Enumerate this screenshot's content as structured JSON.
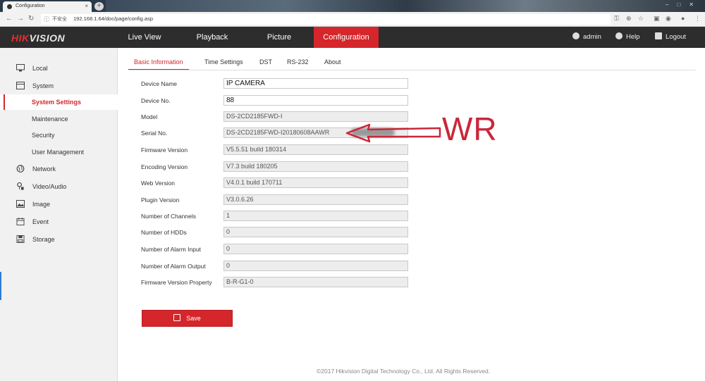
{
  "browser": {
    "tab_title": "Configuration",
    "tab_close": "×",
    "new_tab": "+",
    "address": {
      "security_warning": "不安全",
      "url": "192.168.1.64/doc/page/config.asp"
    }
  },
  "header": {
    "logo_red": "HIK",
    "logo_white": "VISION",
    "nav": [
      {
        "label": "Live View"
      },
      {
        "label": "Playback"
      },
      {
        "label": "Picture"
      },
      {
        "label": "Configuration"
      }
    ],
    "user": "admin",
    "help": "Help",
    "logout": "Logout"
  },
  "sidebar": {
    "items": [
      {
        "label": "Local"
      },
      {
        "label": "System"
      },
      {
        "label": "System Settings"
      },
      {
        "label": "Maintenance"
      },
      {
        "label": "Security"
      },
      {
        "label": "User Management"
      },
      {
        "label": "Network"
      },
      {
        "label": "Video/Audio"
      },
      {
        "label": "Image"
      },
      {
        "label": "Event"
      },
      {
        "label": "Storage"
      }
    ]
  },
  "tabs": [
    {
      "label": "Basic Information"
    },
    {
      "label": "Time Settings"
    },
    {
      "label": "DST"
    },
    {
      "label": "RS-232"
    },
    {
      "label": "About"
    }
  ],
  "fields": [
    {
      "label": "Device Name",
      "value": "IP CAMERA"
    },
    {
      "label": "Device No.",
      "value": "88"
    },
    {
      "label": "Model",
      "value": "DS-2CD2185FWD-I"
    },
    {
      "label": "Serial No.",
      "value": "DS-2CD2185FWD-I20180608AAWR"
    },
    {
      "label": "Firmware Version",
      "value": "V5.5.51 build 180314"
    },
    {
      "label": "Encoding Version",
      "value": "V7.3 build 180205"
    },
    {
      "label": "Web Version",
      "value": "V4.0.1 build 170711"
    },
    {
      "label": "Plugin Version",
      "value": "V3.0.6.26"
    },
    {
      "label": "Number of Channels",
      "value": "1"
    },
    {
      "label": "Number of HDDs",
      "value": "0"
    },
    {
      "label": "Number of Alarm Input",
      "value": "0"
    },
    {
      "label": "Number of Alarm Output",
      "value": "0"
    },
    {
      "label": "Firmware Version Property",
      "value": "B-R-G1-0"
    }
  ],
  "save_label": "Save",
  "footer": "©2017 Hikvision Digital Technology Co., Ltd. All Rights Reserved.",
  "annotation": {
    "text": "WR",
    "color": "#c8283a"
  },
  "colors": {
    "accent": "#d5262b",
    "header_bg": "#2d2d2d"
  }
}
